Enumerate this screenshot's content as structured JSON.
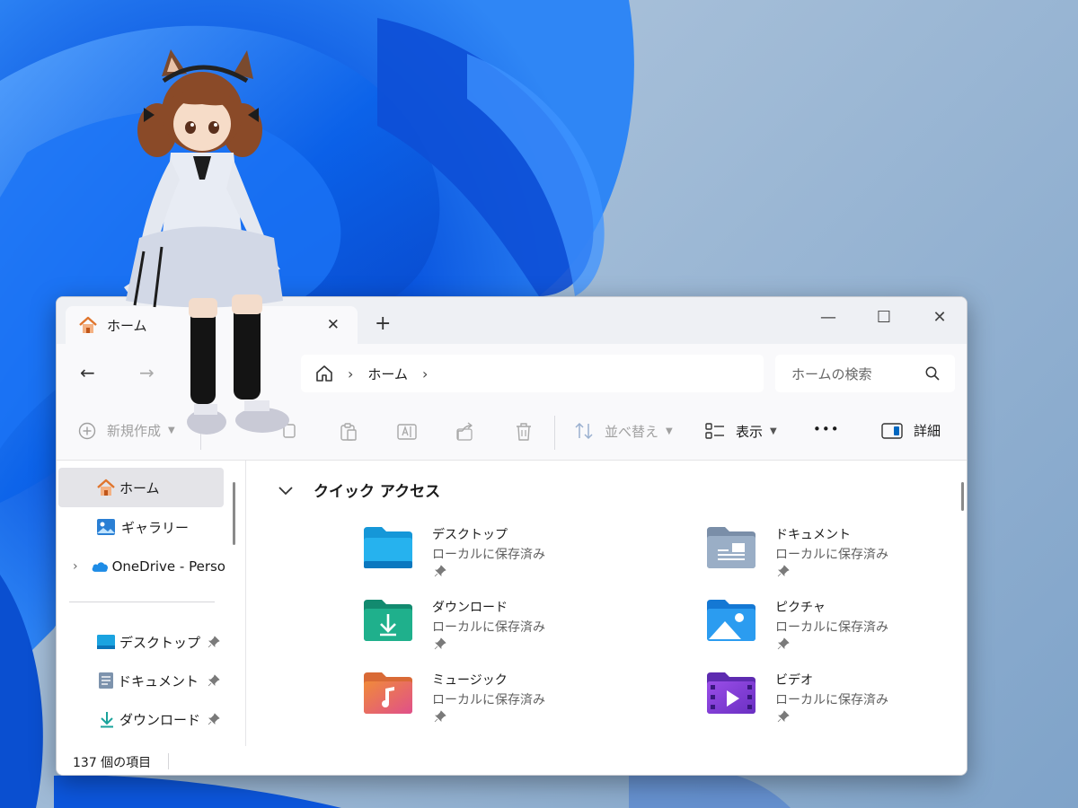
{
  "colors": {
    "wallpaper_blue": "#0a5ce6",
    "window_bg": "#ffffff",
    "toolbar_bg": "#f9f9fb",
    "accent": "#0067c0"
  },
  "tab": {
    "title": "ホーム",
    "icon": "home-icon",
    "close": "✕",
    "new_tab": "+"
  },
  "window_controls": {
    "minimize": "—",
    "maximize": "☐",
    "close": "✕"
  },
  "nav": {
    "back": "←",
    "forward": "→",
    "up": "↑"
  },
  "address": {
    "home_icon": "home-outline-icon",
    "sep1": "›",
    "location": "ホーム",
    "sep2": "›"
  },
  "search": {
    "placeholder": "ホームの検索"
  },
  "toolbar": {
    "new_label": "新規作成",
    "sort_label": "並べ替え",
    "view_label": "表示",
    "more_label": "•••",
    "details_label": "詳細"
  },
  "sidebar": {
    "items": [
      {
        "label": "ホーム",
        "icon": "home-icon"
      },
      {
        "label": "ギャラリー",
        "icon": "gallery-icon"
      },
      {
        "label": "OneDrive - Perso",
        "icon": "onedrive-icon"
      },
      {
        "label": "デスクトップ",
        "icon": "desktop-folder-icon"
      },
      {
        "label": "ドキュメント",
        "icon": "documents-folder-icon"
      },
      {
        "label": "ダウンロード",
        "icon": "download-icon"
      }
    ]
  },
  "content": {
    "section_title": "クイック アクセス",
    "quick_access": [
      {
        "name": "デスクトップ",
        "status": "ローカルに保存済み",
        "icon": "desktop-folder-icon"
      },
      {
        "name": "ドキュメント",
        "status": "ローカルに保存済み",
        "icon": "documents-folder-icon"
      },
      {
        "name": "ダウンロード",
        "status": "ローカルに保存済み",
        "icon": "downloads-folder-icon"
      },
      {
        "name": "ピクチャ",
        "status": "ローカルに保存済み",
        "icon": "pictures-folder-icon"
      },
      {
        "name": "ミュージック",
        "status": "ローカルに保存済み",
        "icon": "music-folder-icon"
      },
      {
        "name": "ビデオ",
        "status": "ローカルに保存済み",
        "icon": "videos-folder-icon"
      }
    ]
  },
  "status": {
    "item_count": "137 個の項目"
  }
}
